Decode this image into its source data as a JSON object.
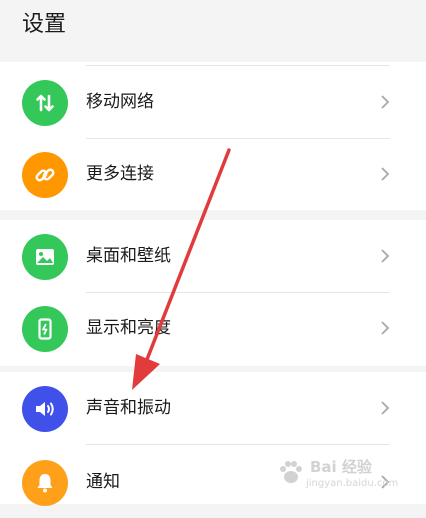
{
  "page": {
    "title": "设置"
  },
  "colors": {
    "green": "#34c759",
    "orange": "#ff9800",
    "blue": "#3f51e8",
    "yellow_orange": "#ffa01a",
    "arrow": "#e23b3b"
  },
  "groups": [
    {
      "items": [
        {
          "label": "移动网络",
          "icon": "mobile-data-arrows-icon",
          "color": "green"
        },
        {
          "label": "更多连接",
          "icon": "link-chain-icon",
          "color": "orange"
        }
      ]
    },
    {
      "items": [
        {
          "label": "桌面和壁纸",
          "icon": "wallpaper-image-icon",
          "color": "green"
        },
        {
          "label": "显示和亮度",
          "icon": "display-brightness-icon",
          "color": "green"
        }
      ]
    },
    {
      "items": [
        {
          "label": "声音和振动",
          "icon": "speaker-volume-icon",
          "color": "blue"
        },
        {
          "label": "通知",
          "icon": "notification-bell-icon",
          "color": "yellow_orange"
        }
      ]
    }
  ],
  "watermark": {
    "text": "Bai 经验",
    "url": "jingyan.baidu.com"
  }
}
